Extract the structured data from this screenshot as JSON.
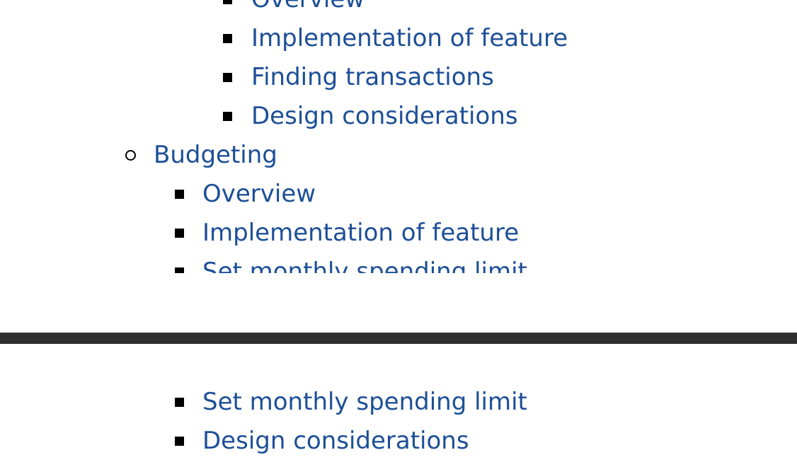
{
  "outline": {
    "top_pane": {
      "finding_transactions_section_items": [
        "Overview",
        "Implementation of feature",
        "Finding transactions",
        "Design considerations"
      ],
      "budgeting_heading": "Budgeting",
      "budgeting_items": [
        "Overview",
        "Implementation of feature",
        "Set monthly spending limit"
      ]
    },
    "bottom_pane": {
      "budgeting_items": [
        "Set monthly spending limit",
        "Design considerations"
      ]
    }
  },
  "colors": {
    "link": "#1c4f96",
    "bullet": "#000000",
    "divider": "#2f2f2f",
    "background": "#ffffff"
  },
  "icons": {
    "level2_bullet": "hollow-circle",
    "level3_bullet": "filled-square"
  }
}
